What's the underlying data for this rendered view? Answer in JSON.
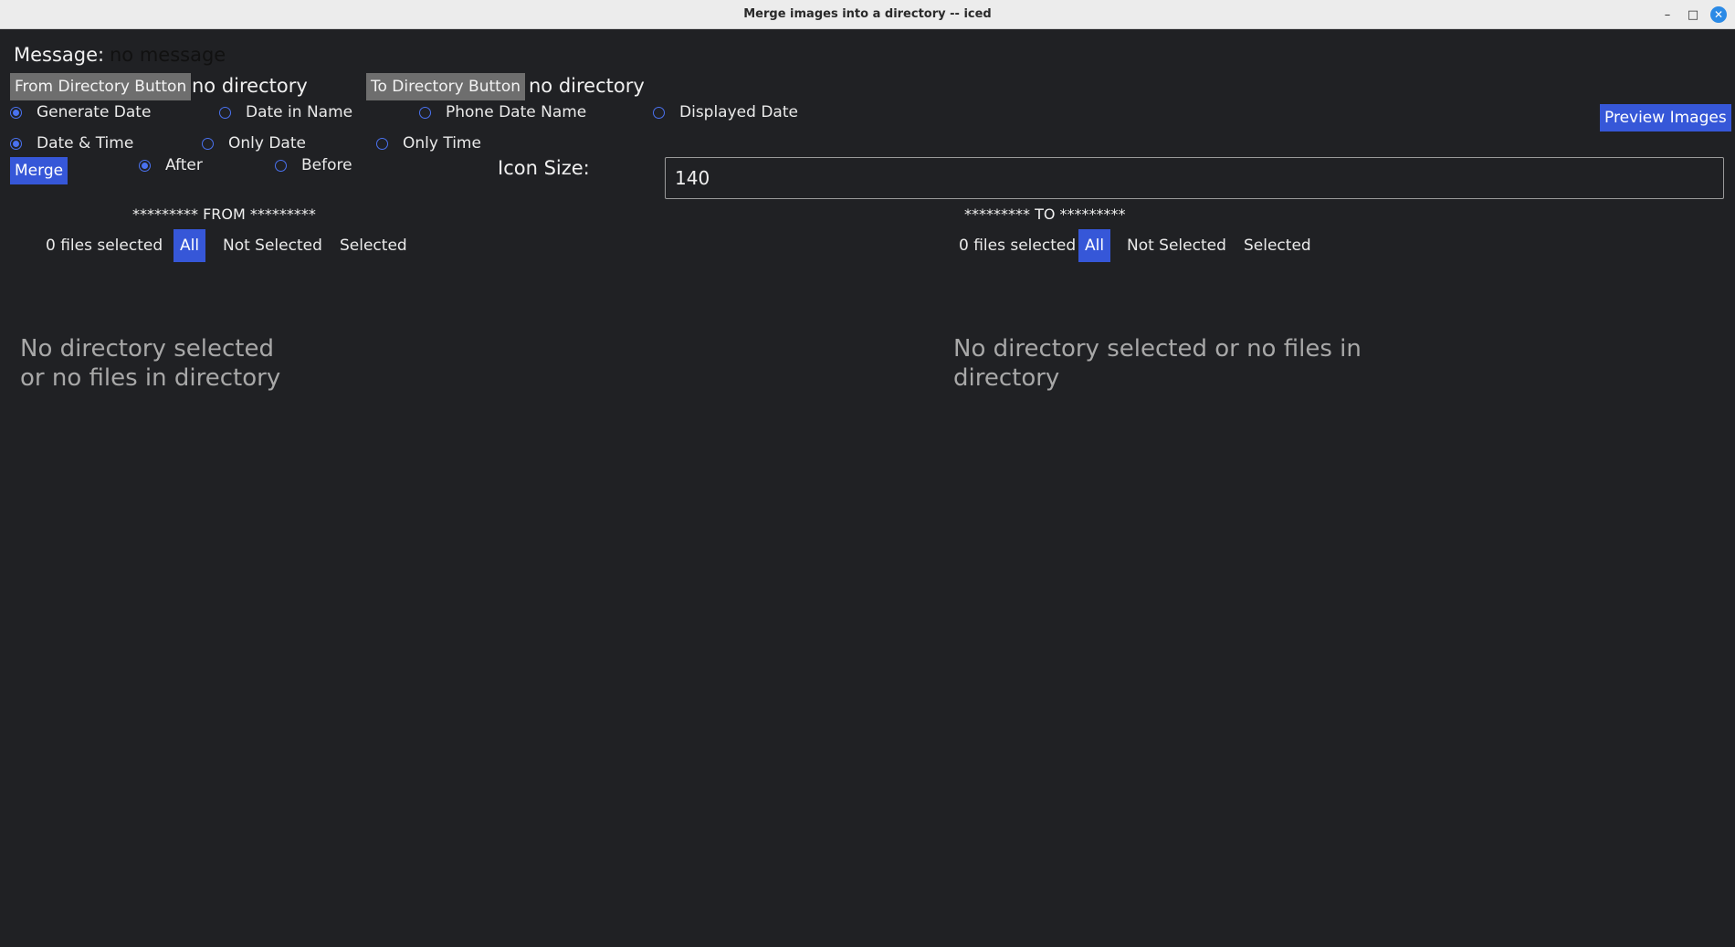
{
  "window": {
    "title": "Merge images into a directory -- iced",
    "minimize_glyph": "–",
    "maximize_glyph": "□",
    "close_glyph": "✕"
  },
  "message": {
    "label": "Message:",
    "value": "no message"
  },
  "directories": {
    "from_button": "From Directory Button",
    "from_value": "no directory",
    "to_button": "To Directory Button",
    "to_value": "no directory"
  },
  "date_source": {
    "options": [
      "Generate Date",
      "Date in Name",
      "Phone Date Name",
      "Displayed Date"
    ],
    "selected": "Generate Date"
  },
  "date_format": {
    "options": [
      "Date & Time",
      "Only Date",
      "Only Time"
    ],
    "selected": "Date & Time"
  },
  "position": {
    "options": [
      "After",
      "Before"
    ],
    "selected": "After"
  },
  "actions": {
    "preview": "Preview Images",
    "merge": "Merge"
  },
  "icon_size": {
    "label": "Icon Size:",
    "value": "140"
  },
  "from_panel": {
    "heading": "********* FROM *********",
    "count": "0 files selected",
    "filters": [
      "All",
      "Not Selected",
      "Selected"
    ],
    "active_filter": "All",
    "empty": "No directory selected or no files in directory"
  },
  "to_panel": {
    "heading": "********* TO *********",
    "count": "0 files selected",
    "filters": [
      "All",
      "Not Selected",
      "Selected"
    ],
    "active_filter": "All",
    "empty": "No directory selected or no files in directory"
  },
  "colors": {
    "background": "#202124",
    "accent": "#3657d8",
    "button_gray": "#6e6e6e"
  }
}
